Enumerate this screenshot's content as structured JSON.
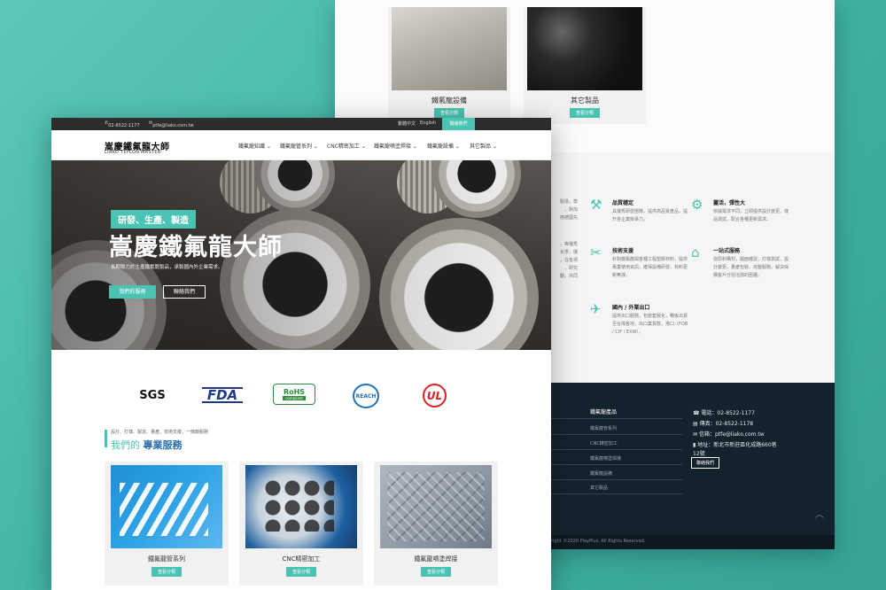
{
  "back_page": {
    "products": [
      {
        "name": "鐵氟龍設備",
        "button": "查看分類"
      },
      {
        "name": "其它製品",
        "button": "查看分類"
      }
    ],
    "left_fragments": [
      "製造，尊\n，對加\n用德國先",
      "，等優秀\n化學，爆\n，在各項\n，研究\n動，共同"
    ],
    "features": [
      {
        "icon": "⚒",
        "title": "品質穩定",
        "desc": "具優秀研發團隊，提供高品質產品，提升各企業競爭力。"
      },
      {
        "icon": "⚙",
        "title": "靈活，彈性大",
        "desc": "依據需求不同，立即提供設計變更，樣品測試，配合各種更新需求。"
      },
      {
        "icon": "✂",
        "title": "技術支援",
        "desc": "針對鐵氟龍與各種工程塑膠材料，提供專業使用資訊，確保設備研發，材料更新無誤。"
      },
      {
        "icon": "⌂",
        "title": "一站式服務",
        "desc": "從原料購材，圖面確認，打樣測試，設計變更，量產包裝，完整服務，解決採購客戶分別洽詢的困擾。"
      },
      {
        "icon": "✈",
        "title": "國內 / 外業出口",
        "desc": "提供出口服務，包裝套製化，鴨板出貨至台灣各地，出口業貨款，港口（FOB / CIF / EXW）。"
      }
    ],
    "footer": {
      "products_title": "鐵氟龍產品",
      "links": [
        "鐵氟龍管系列",
        "CNC精密加工",
        "鐵氟龍噴塗焊接",
        "鐵氟龍設備",
        "其它製品"
      ],
      "phone_label": "電話：",
      "phone": "02-8522-1177",
      "fax_label": "傳真：",
      "fax": "02-8522-1178",
      "email_label": "信箱：",
      "email": "ptfe@liako.com.tw",
      "address_label": "地址：",
      "address_line1": "新北市新莊區化成路660巷",
      "address_line2": "12號",
      "contact_button": "聯絡我們",
      "copyright": "right ©2020 PlayPlus. All Rights Reserved."
    }
  },
  "front_page": {
    "topbar": {
      "phone": "02-8522-1177",
      "email": "ptfe@liako.com.tw",
      "lang_zh": "繁體中文",
      "lang_en": "English",
      "contact": "聯絡我們"
    },
    "logo": {
      "zh": "嵩慶鐵氟龍大師",
      "en": "LIAKO TEFLON MASTER"
    },
    "nav": [
      "鐵氟龍知識",
      "鐵氟龍管系列",
      "CNC精密加工",
      "鐵氟龍噴塗焊接",
      "鐵氟龍設備",
      "其它製品"
    ],
    "hero": {
      "tag": "研發、生產、製造",
      "title": "嵩慶鐵氟龍大師",
      "subtitle": "長期致力於生產鐵氟龍製品，承製國內外企業需求。",
      "button_primary": "我們的服務",
      "button_secondary": "聯絡我們"
    },
    "certifications": [
      "SGS",
      "FDA",
      "RoHS",
      "compliant",
      "REACH",
      "UL"
    ],
    "services_section": {
      "subtitle": "設計、打樣、製造、量產、技術支援，一條龍服務",
      "title_a": "我們的",
      "title_b": "專業服務"
    },
    "services": [
      {
        "name": "鐵氟龍管系列",
        "button": "查看分類"
      },
      {
        "name": "CNC精密加工",
        "button": "查看分類"
      },
      {
        "name": "鐵氟龍噴塗焊接",
        "button": "查看分類"
      }
    ]
  },
  "colors": {
    "accent": "#4bc3b3",
    "footer_bg": "#13232e",
    "background": "#49bcac"
  }
}
